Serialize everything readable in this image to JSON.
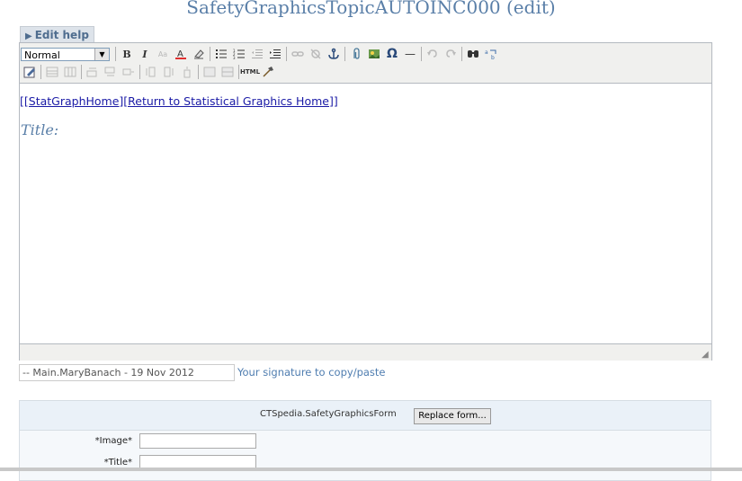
{
  "page": {
    "title": "SafetyGraphicsTopicAUTOINC000 (edit)",
    "edit_help_label": "Edit help"
  },
  "toolbar": {
    "format_select": "Normal",
    "bold": "B",
    "italic": "I",
    "omega": "Ω",
    "hr": "—",
    "html": "HTML"
  },
  "editor": {
    "link_text": "[[StatGraphHome][Return to Statistical Graphics Home]]",
    "title_label": "Title:"
  },
  "signature": {
    "value": "-- Main.MaryBanach - 19 Nov 2012",
    "hint": "Your signature to copy/paste"
  },
  "form": {
    "name": "CTSpedia.SafetyGraphicsForm",
    "replace_button": "Replace form...",
    "fields": [
      {
        "label": "*Image*",
        "value": ""
      },
      {
        "label": "*Title*",
        "value": ""
      }
    ]
  },
  "colors": {
    "accent": "#5a7fa8",
    "link": "#1a1aa6"
  }
}
